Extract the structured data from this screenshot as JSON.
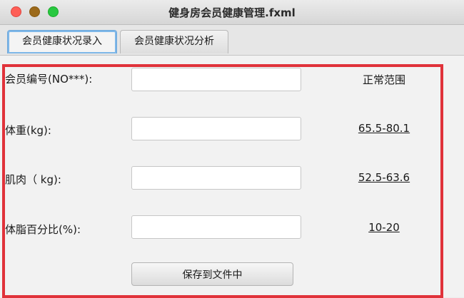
{
  "window": {
    "title": "健身房会员健康管理.fxml"
  },
  "tabs": [
    {
      "label": "会员健康状况录入",
      "active": true
    },
    {
      "label": "会员健康状况分析",
      "active": false
    }
  ],
  "form": {
    "range_header": "正常范围",
    "rows": [
      {
        "label": "会员编号(NO***):",
        "value": "",
        "range": ""
      },
      {
        "label": "体重(kg):",
        "value": "",
        "range": "65.5-80.1"
      },
      {
        "label": "肌肉（ kg):",
        "value": "",
        "range": "52.5-63.6"
      },
      {
        "label": "体脂百分比(%):",
        "value": "",
        "range": "10-20"
      }
    ],
    "save_label": "保存到文件中"
  },
  "colors": {
    "highlight": "#e0323a",
    "tab_focus": "#6ea8dc"
  }
}
